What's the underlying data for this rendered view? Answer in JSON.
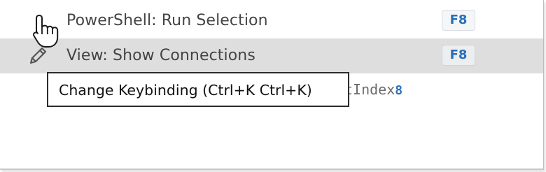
{
  "command_list": {
    "rows": [
      {
        "label": "PowerShell: Run Selection",
        "key": "F8"
      },
      {
        "label": "View: Show Connections",
        "key": "F8"
      }
    ],
    "partial_row": {
      "text": "tIndex",
      "number": "8"
    }
  },
  "tooltip": {
    "text": "Change Keybinding (Ctrl+K Ctrl+K)"
  },
  "icons": {
    "edit": "pencil-icon",
    "cursor": "hand-cursor-icon"
  },
  "colors": {
    "selected_row_bg": "#dedede",
    "keycap_text": "#2970b7",
    "label_text": "#444444"
  }
}
